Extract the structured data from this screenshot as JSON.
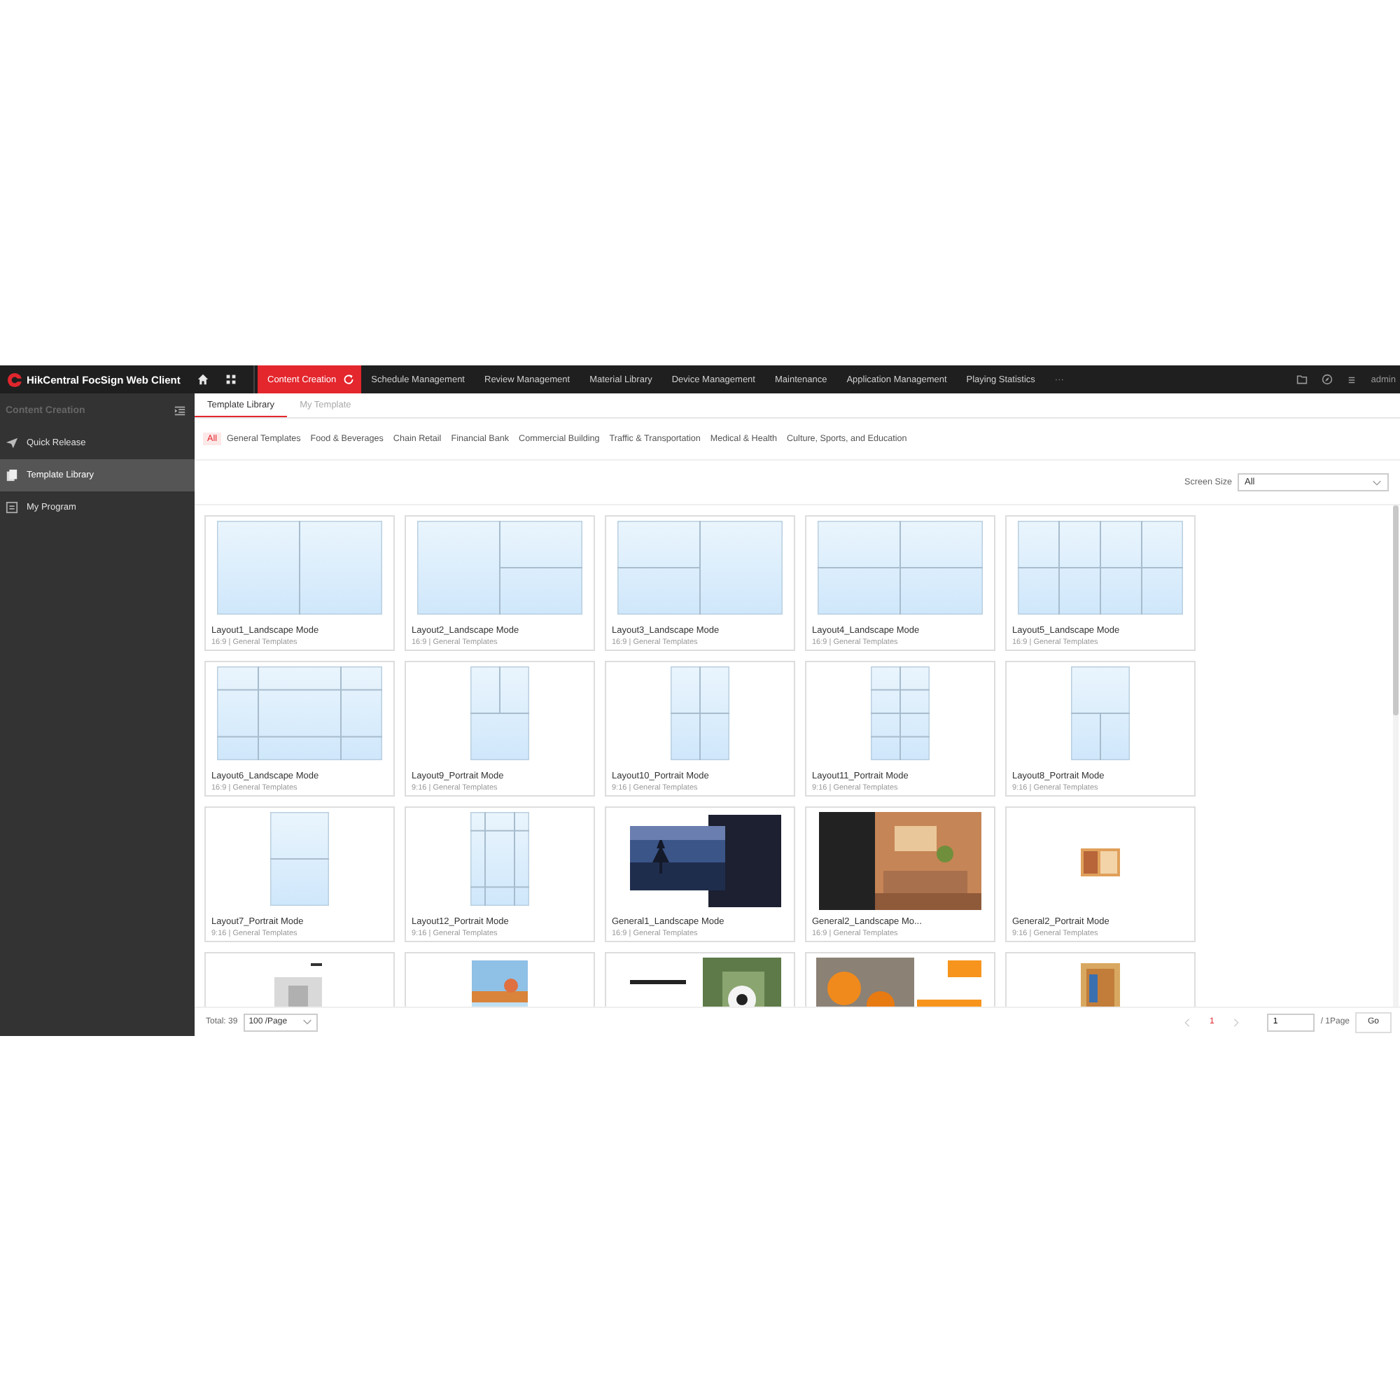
{
  "app": {
    "title": "HikCentral FocSign Web Client"
  },
  "nav": [
    {
      "label": "Content Creation",
      "selected": true
    },
    {
      "label": "Schedule Management",
      "selected": false
    },
    {
      "label": "Review Management",
      "selected": false
    },
    {
      "label": "Material Library",
      "selected": false
    },
    {
      "label": "Device Management",
      "selected": false
    },
    {
      "label": "Maintenance",
      "selected": false
    },
    {
      "label": "Application Management",
      "selected": false
    },
    {
      "label": "Playing Statistics",
      "selected": false
    }
  ],
  "nav_more": "···",
  "user": "admin",
  "sidebar": {
    "title": "Content Creation",
    "items": [
      {
        "label": "Quick Release",
        "selected": false
      },
      {
        "label": "Template Library",
        "selected": true
      },
      {
        "label": "My Program",
        "selected": false
      }
    ]
  },
  "tabs": [
    {
      "label": "Template Library",
      "selected": true
    },
    {
      "label": "My Template",
      "selected": false
    }
  ],
  "categories": [
    {
      "label": "All",
      "selected": true
    },
    {
      "label": "General Templates",
      "selected": false
    },
    {
      "label": "Food & Beverages",
      "selected": false
    },
    {
      "label": "Chain Retail",
      "selected": false
    },
    {
      "label": "Financial Bank",
      "selected": false
    },
    {
      "label": "Commercial Building",
      "selected": false
    },
    {
      "label": "Traffic & Transportation",
      "selected": false
    },
    {
      "label": "Medical & Health",
      "selected": false
    },
    {
      "label": "Culture, Sports, and Education",
      "selected": false
    }
  ],
  "screen_size": {
    "label": "Screen Size",
    "value": "All"
  },
  "cards": [
    {
      "kind": "layout",
      "title": "Layout1_Landscape Mode",
      "meta": "16:9 | General Templates"
    },
    {
      "kind": "layout",
      "title": "Layout2_Landscape Mode",
      "meta": "16:9 | General Templates"
    },
    {
      "kind": "layout",
      "title": "Layout3_Landscape Mode",
      "meta": "16:9 | General Templates"
    },
    {
      "kind": "layout",
      "title": "Layout4_Landscape Mode",
      "meta": "16:9 | General Templates"
    },
    {
      "kind": "layout",
      "title": "Layout5_Landscape Mode",
      "meta": "16:9 | General Templates"
    },
    {
      "kind": "layout",
      "title": "Layout6_Landscape Mode",
      "meta": "16:9 | General Templates"
    },
    {
      "kind": "layout",
      "title": "Layout9_Portrait Mode",
      "meta": "9:16 | General Templates"
    },
    {
      "kind": "layout",
      "title": "Layout10_Portrait Mode",
      "meta": "9:16 | General Templates"
    },
    {
      "kind": "layout",
      "title": "Layout11_Portrait Mode",
      "meta": "9:16 | General Templates"
    },
    {
      "kind": "layout",
      "title": "Layout8_Portrait Mode",
      "meta": "9:16 | General Templates"
    },
    {
      "kind": "layout",
      "title": "Layout7_Portrait Mode",
      "meta": "9:16 | General Templates"
    },
    {
      "kind": "layout",
      "title": "Layout12_Portrait Mode",
      "meta": "9:16 | General Templates"
    },
    {
      "kind": "picture",
      "title": "General1_Landscape Mode",
      "meta": "16:9 | General Templates"
    },
    {
      "kind": "picture",
      "title": "General2_Landscape Mo...",
      "meta": "16:9 | General Templates"
    },
    {
      "kind": "picture",
      "title": "General2_Portrait Mode",
      "meta": "9:16 | General Templates"
    },
    {
      "kind": "picture"
    },
    {
      "kind": "picture"
    },
    {
      "kind": "picture"
    },
    {
      "kind": "picture"
    },
    {
      "kind": "picture"
    }
  ],
  "pagination": {
    "total": "Total: 39",
    "page_size": "100 /Page",
    "pages": [
      {
        "label": "1",
        "selected": true
      }
    ],
    "page_input": "1",
    "page_count": "/ 1Page",
    "go": "Go"
  }
}
